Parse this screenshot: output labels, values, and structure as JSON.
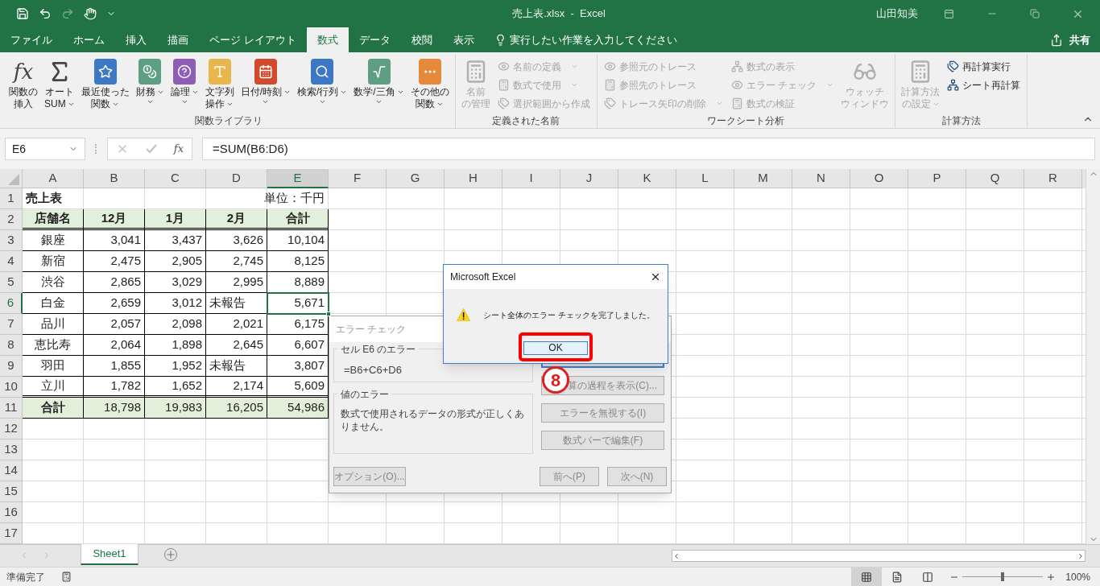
{
  "title_bar": {
    "title": "売上表.xlsx  -  Excel",
    "user": "山田知美"
  },
  "menu_tabs": [
    {
      "label": "ファイル",
      "selected": false
    },
    {
      "label": "ホーム",
      "selected": false
    },
    {
      "label": "挿入",
      "selected": false
    },
    {
      "label": "描画",
      "selected": false
    },
    {
      "label": "ページ レイアウト",
      "selected": false
    },
    {
      "label": "数式",
      "selected": true
    },
    {
      "label": "データ",
      "selected": false
    },
    {
      "label": "校閲",
      "selected": false
    },
    {
      "label": "表示",
      "selected": false
    }
  ],
  "tell_me": "実行したい作業を入力してください",
  "share": "共有",
  "ribbon": {
    "groups": [
      {
        "label": "関数ライブラリ",
        "items": [
          {
            "kind": "large",
            "lines": [
              "関数の",
              "挿入"
            ],
            "glyph": "fx",
            "dropdown": false,
            "disabled": false
          },
          {
            "kind": "large",
            "lines": [
              "オート",
              "SUM"
            ],
            "dropdown": true,
            "disabled": false
          },
          {
            "kind": "large",
            "lines": [
              "最近使った",
              "関数"
            ],
            "dropdown": true,
            "disabled": false
          },
          {
            "kind": "large",
            "lines": [
              "財務"
            ],
            "dropdown": true,
            "disabled": false
          },
          {
            "kind": "large",
            "lines": [
              "論理"
            ],
            "dropdown": true,
            "disabled": false
          },
          {
            "kind": "large",
            "lines": [
              "文字列",
              "操作"
            ],
            "dropdown": true,
            "disabled": false
          },
          {
            "kind": "large",
            "lines": [
              "日付/時刻"
            ],
            "dropdown": true,
            "disabled": false
          },
          {
            "kind": "large",
            "lines": [
              "検索/行列"
            ],
            "dropdown": true,
            "disabled": false
          },
          {
            "kind": "large",
            "lines": [
              "数学/三角"
            ],
            "dropdown": true,
            "disabled": false
          },
          {
            "kind": "large",
            "lines": [
              "その他の",
              "関数"
            ],
            "dropdown": true,
            "disabled": false
          }
        ]
      },
      {
        "label": "定義された名前",
        "items": [
          {
            "kind": "large",
            "lines": [
              "名前",
              "の管理"
            ],
            "dropdown": false,
            "disabled": true
          },
          {
            "kind": "small",
            "label": "名前の定義",
            "dropdown": true,
            "disabled": true
          },
          {
            "kind": "small",
            "label": "数式で使用",
            "dropdown": true,
            "disabled": true
          },
          {
            "kind": "small",
            "label": "選択範囲から作成",
            "dropdown": false,
            "disabled": true
          }
        ]
      },
      {
        "label": "ワークシート分析",
        "items": [
          {
            "kind": "small",
            "label": "参照元のトレース",
            "dropdown": false,
            "disabled": true
          },
          {
            "kind": "small",
            "label": "参照先のトレース",
            "dropdown": false,
            "disabled": true
          },
          {
            "kind": "small",
            "label": "トレース矢印の削除",
            "dropdown": true,
            "disabled": true
          },
          {
            "kind": "small",
            "label": "数式の表示",
            "dropdown": false,
            "disabled": true
          },
          {
            "kind": "small",
            "label": "エラー チェック",
            "dropdown": true,
            "disabled": true
          },
          {
            "kind": "small",
            "label": "数式の検証",
            "dropdown": false,
            "disabled": true
          },
          {
            "kind": "large",
            "lines": [
              "ウォッチ",
              "ウィンドウ"
            ],
            "dropdown": false,
            "disabled": true
          }
        ]
      },
      {
        "label": "計算方法",
        "items": [
          {
            "kind": "large",
            "lines": [
              "計算方法",
              "の設定"
            ],
            "dropdown": true,
            "disabled": true
          },
          {
            "kind": "small",
            "label": "再計算実行",
            "dropdown": false,
            "disabled": false
          },
          {
            "kind": "small",
            "label": "シート再計算",
            "dropdown": false,
            "disabled": false
          }
        ]
      }
    ]
  },
  "formula_bar": {
    "name_box": "E6",
    "fx": "fx",
    "formula": "=SUM(B6:D6)"
  },
  "sheet": {
    "columns": [
      "A",
      "B",
      "C",
      "D",
      "E",
      "F",
      "G",
      "H",
      "I",
      "J",
      "K",
      "L",
      "M",
      "N",
      "O",
      "P",
      "Q",
      "R"
    ],
    "rows": [
      {
        "header": "1",
        "kind": "title",
        "cells": [
          {
            "text": "売上表",
            "kind": "title",
            "selected": false
          },
          {
            "kind": "blank",
            "selected": false
          },
          {
            "kind": "blank",
            "selected": false
          },
          {
            "kind": "blank",
            "selected": false
          },
          {
            "text": "単位：千円",
            "kind": "unit",
            "selected": false
          }
        ]
      },
      {
        "header": "2",
        "kind": "header",
        "cells": [
          {
            "text": "店舗名",
            "kind": "label",
            "selected": false
          },
          {
            "text": "12月",
            "kind": "label",
            "selected": false
          },
          {
            "text": "1月",
            "kind": "label",
            "selected": false
          },
          {
            "text": "2月",
            "kind": "label",
            "selected": false
          },
          {
            "text": "合計",
            "kind": "label",
            "selected": false
          }
        ]
      },
      {
        "header": "3",
        "kind": "data",
        "cells": [
          {
            "text": "銀座",
            "kind": "label",
            "selected": false
          },
          {
            "text": "3,041",
            "kind": "number",
            "selected": false
          },
          {
            "text": "3,437",
            "kind": "number",
            "selected": false
          },
          {
            "text": "3,626",
            "kind": "number",
            "selected": false
          },
          {
            "text": "10,104",
            "kind": "number",
            "selected": false
          }
        ]
      },
      {
        "header": "4",
        "kind": "data",
        "cells": [
          {
            "text": "新宿",
            "kind": "label",
            "selected": false
          },
          {
            "text": "2,475",
            "kind": "number",
            "selected": false
          },
          {
            "text": "2,905",
            "kind": "number",
            "selected": false
          },
          {
            "text": "2,745",
            "kind": "number",
            "selected": false
          },
          {
            "text": "8,125",
            "kind": "number",
            "selected": false
          }
        ]
      },
      {
        "header": "5",
        "kind": "data",
        "cells": [
          {
            "text": "渋谷",
            "kind": "label",
            "selected": false
          },
          {
            "text": "2,865",
            "kind": "number",
            "selected": false
          },
          {
            "text": "3,029",
            "kind": "number",
            "selected": false
          },
          {
            "text": "2,995",
            "kind": "number",
            "selected": false
          },
          {
            "text": "8,889",
            "kind": "number",
            "selected": false
          }
        ]
      },
      {
        "header": "6",
        "kind": "data",
        "cells": [
          {
            "text": "白金",
            "kind": "label",
            "selected": false
          },
          {
            "text": "2,659",
            "kind": "number",
            "selected": false
          },
          {
            "text": "3,012",
            "kind": "number",
            "selected": false
          },
          {
            "text": "未報告",
            "kind": "text",
            "selected": false
          },
          {
            "text": "5,671",
            "kind": "number",
            "selected": true
          }
        ]
      },
      {
        "header": "7",
        "kind": "data",
        "cells": [
          {
            "text": "品川",
            "kind": "label",
            "selected": false
          },
          {
            "text": "2,057",
            "kind": "number",
            "selected": false
          },
          {
            "text": "2,098",
            "kind": "number",
            "selected": false
          },
          {
            "text": "2,021",
            "kind": "number",
            "selected": false
          },
          {
            "text": "6,175",
            "kind": "number",
            "selected": false
          }
        ]
      },
      {
        "header": "8",
        "kind": "data",
        "cells": [
          {
            "text": "恵比寿",
            "kind": "label",
            "selected": false
          },
          {
            "text": "2,064",
            "kind": "number",
            "selected": false
          },
          {
            "text": "1,898",
            "kind": "number",
            "selected": false
          },
          {
            "text": "2,645",
            "kind": "number",
            "selected": false
          },
          {
            "text": "6,607",
            "kind": "number",
            "selected": false
          }
        ]
      },
      {
        "header": "9",
        "kind": "data",
        "cells": [
          {
            "text": "羽田",
            "kind": "label",
            "selected": false
          },
          {
            "text": "1,855",
            "kind": "number",
            "selected": false
          },
          {
            "text": "1,952",
            "kind": "number",
            "selected": false
          },
          {
            "text": "未報告",
            "kind": "text",
            "selected": false
          },
          {
            "text": "3,807",
            "kind": "number",
            "selected": false
          }
        ]
      },
      {
        "header": "10",
        "kind": "data",
        "cells": [
          {
            "text": "立川",
            "kind": "label",
            "selected": false
          },
          {
            "text": "1,782",
            "kind": "number",
            "selected": false
          },
          {
            "text": "1,652",
            "kind": "number",
            "selected": false
          },
          {
            "text": "2,174",
            "kind": "number",
            "selected": false
          },
          {
            "text": "5,609",
            "kind": "number",
            "selected": false
          }
        ]
      },
      {
        "header": "11",
        "kind": "total",
        "cells": [
          {
            "text": "合計",
            "kind": "label",
            "selected": false
          },
          {
            "text": "18,798",
            "kind": "number",
            "selected": false
          },
          {
            "text": "19,983",
            "kind": "number",
            "selected": false
          },
          {
            "text": "16,205",
            "kind": "number",
            "selected": false
          },
          {
            "text": "54,986",
            "kind": "number",
            "selected": false
          }
        ]
      }
    ],
    "empty_rows": [
      "12",
      "13",
      "14",
      "15",
      "16",
      "17"
    ]
  },
  "error_dialog": {
    "title": "エラー チェック",
    "cell_label": "セル E6 のエラー",
    "formula": "=B6+C6+D6",
    "error_label": "値のエラー",
    "message": "数式で使用されるデータの形式が正しくありません。",
    "buttons": [
      "算の過程を表示(C)...",
      "エラーを無視する(I)",
      "数式バーで編集(F)"
    ],
    "options": "オプション(O)...",
    "prev": "前へ(P)",
    "next": "次へ(N)"
  },
  "message_box": {
    "title": "Microsoft Excel",
    "message": "シート全体のエラー チェックを完了しました。",
    "ok": "OK",
    "step": "8"
  },
  "sheet_tabs": [
    {
      "label": "Sheet1",
      "selected": true
    }
  ],
  "status_bar": {
    "status": "準備完了",
    "views": [
      {
        "selected": true
      },
      {
        "selected": false
      },
      {
        "selected": false
      }
    ],
    "zoom": {
      "level": 0.5,
      "reading": "100%"
    }
  }
}
